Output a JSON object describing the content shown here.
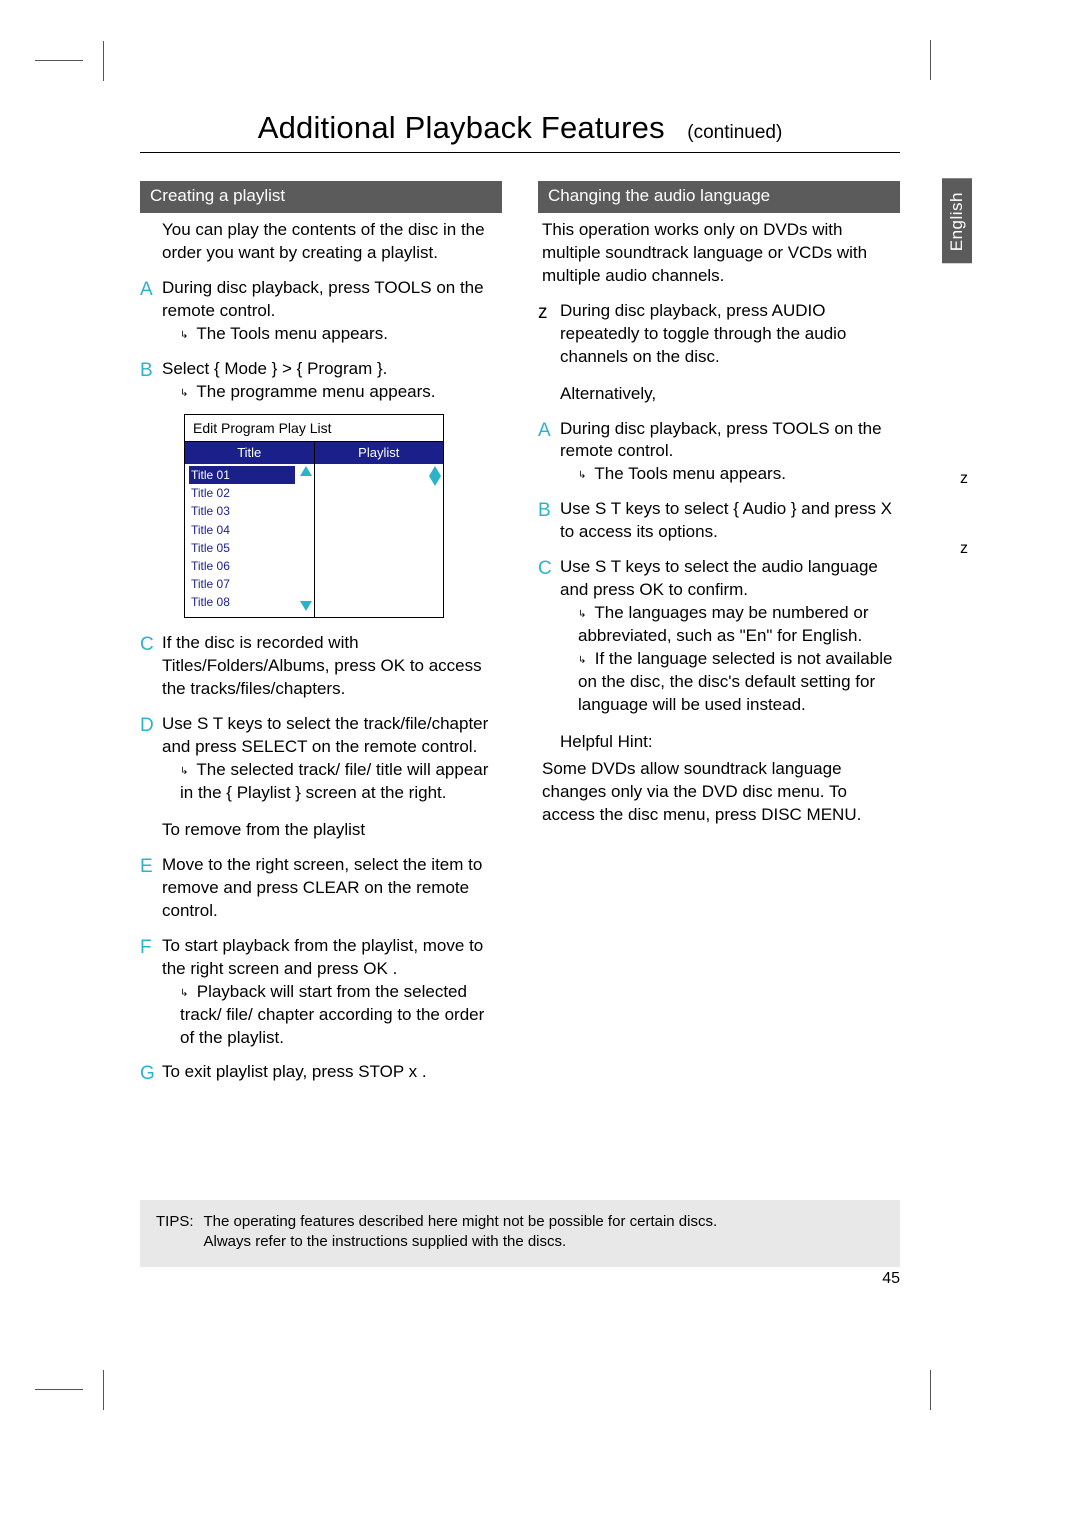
{
  "header": {
    "title": "Additional Playback Features",
    "continued": "(continued)"
  },
  "lang_tab": "English",
  "left": {
    "subhead": "Creating a playlist",
    "intro": "You can play the contents of the disc in the order you want by creating a playlist.",
    "steps": {
      "A": {
        "label": "A",
        "text": "During disc playback, press TOOLS  on the remote control.",
        "result": "The Tools menu appears."
      },
      "B": {
        "label": "B",
        "text": "Select { Mode } > { Program  }.",
        "result": "The programme menu appears."
      },
      "C": {
        "label": "C",
        "text": "If the disc is recorded with Titles/Folders/Albums, press OK  to access the tracks/files/chapters."
      },
      "D": {
        "label": "D",
        "text": "Use  S T keys to select the track/file/chapter and press SELECT  on the remote control.",
        "result": "The selected track/ file/ title will appear in the { Playlist  } screen at the right."
      },
      "remove_title": "To remove from the playlist",
      "E": {
        "label": "E",
        "text": "Move to the right screen, select the item to remove and press CLEAR  on the remote control."
      },
      "F": {
        "label": "F",
        "text": "To start playback from the playlist, move to the right screen and press OK .",
        "result": "Playback will start from the selected track/ file/ chapter according to the order of the playlist."
      },
      "G": {
        "label": "G",
        "text": "To exit playlist play, press STOP  x ."
      }
    },
    "diagram": {
      "title": "Edit Program Play List",
      "col1": "Title",
      "col2": "Playlist",
      "titles": [
        "Title 01",
        "Title 02",
        "Title 03",
        "Title 04",
        "Title 05",
        "Title 06",
        "Title 07",
        "Title 08"
      ]
    }
  },
  "right": {
    "subhead": "Changing the audio language",
    "intro": "This operation works only on DVDs with multiple soundtrack language or VCDs with multiple audio channels.",
    "z": {
      "label": "z",
      "text": "During disc playback, press AUDIO repeatedly to toggle through the audio channels on the disc."
    },
    "alt": "Alternatively,",
    "A": {
      "label": "A",
      "text": "During disc playback, press TOOLS  on the remote control.",
      "result": "The Tools menu appears."
    },
    "B": {
      "label": "B",
      "text": "Use  S T keys to select { Audio  } and press  X to access its options."
    },
    "C": {
      "label": "C",
      "text": "Use  S T keys to select the audio language and press OK  to confirm.",
      "result1": "The languages may be numbered or abbreviated, such as \"En\" for English.",
      "result2": "If the language selected is not available on the disc, the disc's default setting for language will be used instead."
    },
    "hint_title": "Helpful Hint:",
    "hint_body": "  Some DVDs allow soundtrack language changes only via the DVD disc menu. To access the disc menu, press DISC MENU."
  },
  "edge": {
    "z1": "z",
    "z2": "z"
  },
  "tips": {
    "label": "TIPS:",
    "line1": "The operating features described here might not be possible for certain discs.",
    "line2": "Always refer to the instructions supplied with the discs."
  },
  "page_number": "45"
}
